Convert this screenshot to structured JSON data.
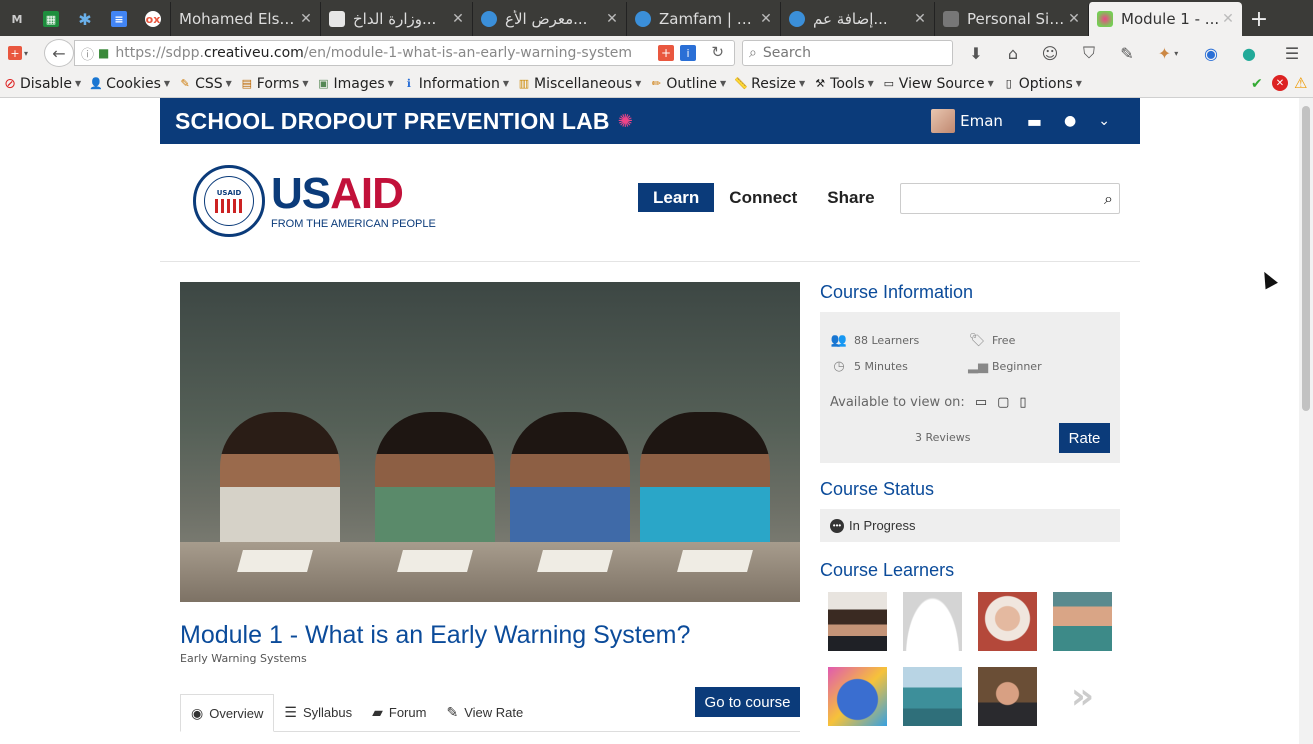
{
  "browser": {
    "pinned_tabs": [
      {
        "icon": "gmail-icon",
        "glyph": "M",
        "color": "#555555"
      },
      {
        "icon": "sheets-icon",
        "glyph": "▦",
        "color": "#1e8e3e"
      },
      {
        "icon": "asterisk-icon",
        "glyph": "✱",
        "color": "#4a8fd0"
      },
      {
        "icon": "docs-icon",
        "glyph": "≡",
        "color": "#4285f4"
      },
      {
        "icon": "odoo-icon",
        "glyph": "ox",
        "color": "#e9573f"
      }
    ],
    "tabs": [
      {
        "title": "Mohamed Elsa...",
        "icon_color": "#f2f2f2",
        "active": false
      },
      {
        "title": "وزارة الداخ...",
        "icon_color": "#e6e6e6",
        "active": false
      },
      {
        "title": "معرض الأع...",
        "icon_color": "#3b8fd9",
        "active": false
      },
      {
        "title": "Zamfam | م...",
        "icon_color": "#3b8fd9",
        "active": false
      },
      {
        "title": "إضافة عم...",
        "icon_color": "#3b8fd9",
        "active": false
      },
      {
        "title": "Personal Sit...",
        "icon_color": "#888888",
        "active": false
      },
      {
        "title": "Module 1 - ...",
        "icon_color": "#e48",
        "active": true
      }
    ],
    "url_prefix": "https://sdpp.",
    "url_domain": "creativeu.com",
    "url_path": "/en/module-1-what-is-an-early-warning-system",
    "search_placeholder": "Search",
    "bookmarks": [
      "Disable",
      "Cookies",
      "CSS",
      "Forms",
      "Images",
      "Information",
      "Miscellaneous",
      "Outline",
      "Resize",
      "Tools",
      "View Source",
      "Options"
    ]
  },
  "site": {
    "brand": "SCHOOL DROPOUT PREVENTION LAB",
    "user_name": "Eman",
    "usaid_word_blue": "US",
    "usaid_word_red": "AID",
    "usaid_tagline": "FROM THE AMERICAN PEOPLE",
    "seal_text": "USAID",
    "nav": [
      "Learn",
      "Connect",
      "Share"
    ],
    "nav_active": "Learn"
  },
  "course": {
    "title": "Module 1 - What is an Early Warning System?",
    "category": "Early Warning Systems",
    "tabs": [
      "Overview",
      "Syllabus",
      "Forum",
      "View Rate"
    ],
    "go_button": "Go to course"
  },
  "sidebar": {
    "info_heading": "Course Information",
    "learners": "88 Learners",
    "price": "Free",
    "duration": "5 Minutes",
    "level": "Beginner",
    "available_label": "Available to view on:",
    "reviews": "3 Reviews",
    "rate_button": "Rate",
    "status_heading": "Course Status",
    "status_value": "In Progress",
    "learners_heading": "Course Learners"
  }
}
